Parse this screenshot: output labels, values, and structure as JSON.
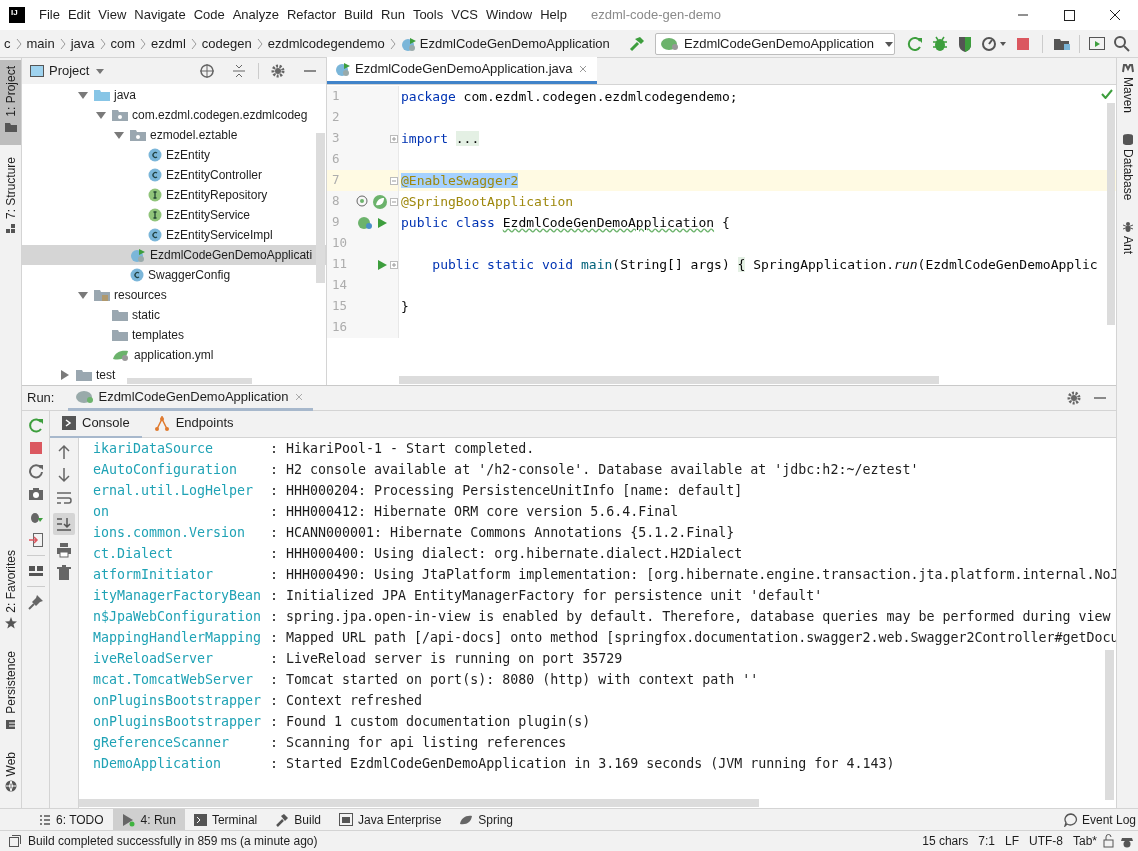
{
  "window": {
    "logo": "IJ",
    "title": "ezdml-code-gen-demo"
  },
  "menu": [
    "File",
    "Edit",
    "View",
    "Navigate",
    "Code",
    "Analyze",
    "Refactor",
    "Build",
    "Run",
    "Tools",
    "VCS",
    "Window",
    "Help"
  ],
  "breadcrumb": [
    "c",
    "main",
    "java",
    "com",
    "ezdml",
    "codegen",
    "ezdmlcodegendemo",
    "EzdmlCodeGenDemoApplication"
  ],
  "run_configuration": "EzdmlCodeGenDemoApplication",
  "left_tool_tabs": [
    {
      "label": "1: Project",
      "selected": true
    },
    {
      "label": "7: Structure",
      "selected": false
    }
  ],
  "left_tool_tabs_bottom": [
    {
      "label": "2: Favorites",
      "kind": "favorites"
    },
    {
      "label": "Persistence",
      "kind": "persistence"
    },
    {
      "label": "Web",
      "kind": "web"
    }
  ],
  "right_tool_tabs": [
    {
      "label": "Maven",
      "kind": "maven"
    },
    {
      "label": "Database",
      "kind": "database"
    },
    {
      "label": "Ant",
      "kind": "ant"
    }
  ],
  "project": {
    "title": "Project",
    "tree": [
      {
        "children": [
          {
            "label": "java",
            "kind": "source-folder",
            "expanded": true,
            "selected": false,
            "children": [
              {
                "label": "com.ezdml.codegen.ezdmlcodeg",
                "kind": "package",
                "expanded": true,
                "selected": false,
                "children": [
                  {
                    "label": "ezmodel.eztable",
                    "kind": "package",
                    "expanded": true,
                    "selected": false,
                    "children": [
                      {
                        "label": "EzEntity",
                        "kind": "class",
                        "selected": false
                      },
                      {
                        "label": "EzEntityController",
                        "kind": "class",
                        "selected": false
                      },
                      {
                        "label": "EzEntityRepository",
                        "kind": "interface",
                        "selected": false
                      },
                      {
                        "label": "EzEntityService",
                        "kind": "interface",
                        "selected": false
                      },
                      {
                        "label": "EzEntityServiceImpl",
                        "kind": "class",
                        "selected": false
                      }
                    ]
                  },
                  {
                    "label": "EzdmlCodeGenDemoApplicati",
                    "kind": "app-class",
                    "selected": true
                  },
                  {
                    "label": "SwaggerConfig",
                    "kind": "class",
                    "selected": false
                  }
                ]
              }
            ]
          },
          {
            "label": "resources",
            "kind": "resources-folder",
            "expanded": true,
            "selected": false,
            "children": [
              {
                "label": "static",
                "kind": "folder",
                "selected": false
              },
              {
                "label": "templates",
                "kind": "folder",
                "selected": false
              },
              {
                "label": "application.yml",
                "kind": "yml",
                "selected": false
              }
            ]
          }
        ]
      },
      {
        "label": "test",
        "kind": "folder",
        "expanded": false,
        "selected": false
      }
    ]
  },
  "editor": {
    "tabs": [
      {
        "label": "EzdmlCodeGenDemoApplication.java",
        "selected": true
      }
    ],
    "lines": [
      {
        "number": "1",
        "current": false,
        "fold_marker": false,
        "bean_marker": false,
        "spring_marker": false,
        "run_marker": false,
        "tokens": [
          {
            "text": "package",
            "kind": "keyword"
          },
          {
            "text": " com.ezdml.codegen.ezdmlcodegendemo;",
            "kind": "plain"
          }
        ]
      },
      {
        "number": "2",
        "current": false,
        "fold_marker": false,
        "bean_marker": false,
        "spring_marker": false,
        "run_marker": false
      },
      {
        "number": "3",
        "current": false,
        "fold_marker": true,
        "folded": true,
        "bean_marker": false,
        "spring_marker": false,
        "run_marker": false,
        "tokens": [
          {
            "text": "import ",
            "kind": "keyword"
          },
          {
            "text": "...",
            "kind": "folded"
          }
        ]
      },
      {
        "number": "6",
        "current": false,
        "fold_marker": false,
        "bean_marker": false,
        "spring_marker": false,
        "run_marker": false
      },
      {
        "number": "7",
        "current": true,
        "fold_marker": true,
        "folded": false,
        "bean_marker": false,
        "spring_marker": false,
        "run_marker": false,
        "tokens": [
          {
            "text": "@EnableSwagger2",
            "kind": "selected-annotation"
          }
        ]
      },
      {
        "number": "8",
        "current": false,
        "fold_marker": true,
        "folded": false,
        "bean_marker": true,
        "spring_marker": true,
        "run_marker": false,
        "tokens": [
          {
            "text": "@SpringBootApplication",
            "kind": "annotation"
          }
        ]
      },
      {
        "number": "9",
        "current": false,
        "fold_marker": false,
        "bean_marker": false,
        "spring_marker": true,
        "run_marker": true,
        "tokens": [
          {
            "text": "public class ",
            "kind": "keyword"
          },
          {
            "text": "EzdmlCodeGenDemoApplication",
            "kind": "typo"
          },
          {
            "text": " {",
            "kind": "plain"
          }
        ]
      },
      {
        "number": "10",
        "current": false,
        "fold_marker": false,
        "bean_marker": false,
        "spring_marker": false,
        "run_marker": false
      },
      {
        "number": "11",
        "current": false,
        "fold_marker": true,
        "folded": true,
        "bean_marker": false,
        "spring_marker": false,
        "run_marker": true,
        "tokens": [
          {
            "text": "    public static void ",
            "kind": "keyword"
          },
          {
            "text": "main",
            "kind": "method"
          },
          {
            "text": "(String[] args) ",
            "kind": "plain"
          },
          {
            "text": "{",
            "kind": "folded"
          },
          {
            "text": " SpringApplication.",
            "kind": "plain"
          },
          {
            "text": "run",
            "kind": "static-call"
          },
          {
            "text": "(EzdmlCodeGenDemoApplic",
            "kind": "plain"
          }
        ]
      },
      {
        "number": "14",
        "current": false,
        "fold_marker": false,
        "bean_marker": false,
        "spring_marker": false,
        "run_marker": false
      },
      {
        "number": "15",
        "current": false,
        "fold_marker": false,
        "bean_marker": false,
        "spring_marker": false,
        "run_marker": false,
        "tokens": [
          {
            "text": "}",
            "kind": "plain"
          }
        ]
      },
      {
        "number": "16",
        "current": false,
        "fold_marker": false,
        "bean_marker": false,
        "spring_marker": false,
        "run_marker": false
      }
    ]
  },
  "run": {
    "title": "Run:",
    "tabs": [
      {
        "label": "EzdmlCodeGenDemoApplication",
        "selected": true
      }
    ],
    "subtabs": [
      {
        "label": "Console",
        "kind": "console",
        "selected": true
      },
      {
        "label": "Endpoints",
        "kind": "endpoints",
        "selected": false
      }
    ],
    "console": [
      {
        "source": "ikariDataSource",
        "message": ": HikariPool-1 - Start completed."
      },
      {
        "source": "eAutoConfiguration",
        "message": ": H2 console available at '/h2-console'. Database available at 'jdbc:h2:~/eztest'"
      },
      {
        "source": "ernal.util.LogHelper",
        "message": ": HHH000204: Processing PersistenceUnitInfo [name: default]"
      },
      {
        "source": "on",
        "message": ": HHH000412: Hibernate ORM core version 5.6.4.Final"
      },
      {
        "source": "ions.common.Version",
        "message": ": HCANN000001: Hibernate Commons Annotations {5.1.2.Final}"
      },
      {
        "source": "ct.Dialect",
        "message": ": HHH000400: Using dialect: org.hibernate.dialect.H2Dialect"
      },
      {
        "source": "atformInitiator",
        "message": ": HHH000490: Using JtaPlatform implementation: [org.hibernate.engine.transaction.jta.platform.internal.NoJ"
      },
      {
        "source": "ityManagerFactoryBean",
        "message": ": Initialized JPA EntityManagerFactory for persistence unit 'default'"
      },
      {
        "source": "n$JpaWebConfiguration",
        "message": ": spring.jpa.open-in-view is enabled by default. Therefore, database queries may be performed during view"
      },
      {
        "source": "MappingHandlerMapping",
        "message": ": Mapped URL path [/api-docs] onto method [springfox.documentation.swagger2.web.Swagger2Controller#getDocu"
      },
      {
        "source": "iveReloadServer",
        "message": ": LiveReload server is running on port 35729"
      },
      {
        "source": "mcat.TomcatWebServer",
        "message": ": Tomcat started on port(s): 8080 (http) with context path ''"
      },
      {
        "source": "onPluginsBootstrapper",
        "message": ": Context refreshed"
      },
      {
        "source": "onPluginsBootstrapper",
        "message": ": Found 1 custom documentation plugin(s)"
      },
      {
        "source": "gReferenceScanner",
        "message": ": Scanning for api listing references"
      },
      {
        "source": "nDemoApplication",
        "message": ": Started EzdmlCodeGenDemoApplication in 3.169 seconds (JVM running for 4.143)"
      }
    ]
  },
  "tool_window_bar": [
    {
      "label": "6: TODO",
      "kind": "todo",
      "selected": false
    },
    {
      "label": "4: Run",
      "kind": "run",
      "selected": true
    },
    {
      "label": "Terminal",
      "kind": "terminal",
      "selected": false
    },
    {
      "label": "Build",
      "kind": "build",
      "selected": false
    },
    {
      "label": "Java Enterprise",
      "kind": "enterprise",
      "selected": false
    },
    {
      "label": "Spring",
      "kind": "spring",
      "selected": false
    }
  ],
  "event_log": "Event Log",
  "status_bar": {
    "message": "Build completed successfully in 859 ms (a minute ago)",
    "items": [
      "15 chars",
      "7:1",
      "LF",
      "UTF-8",
      "Tab*"
    ]
  }
}
